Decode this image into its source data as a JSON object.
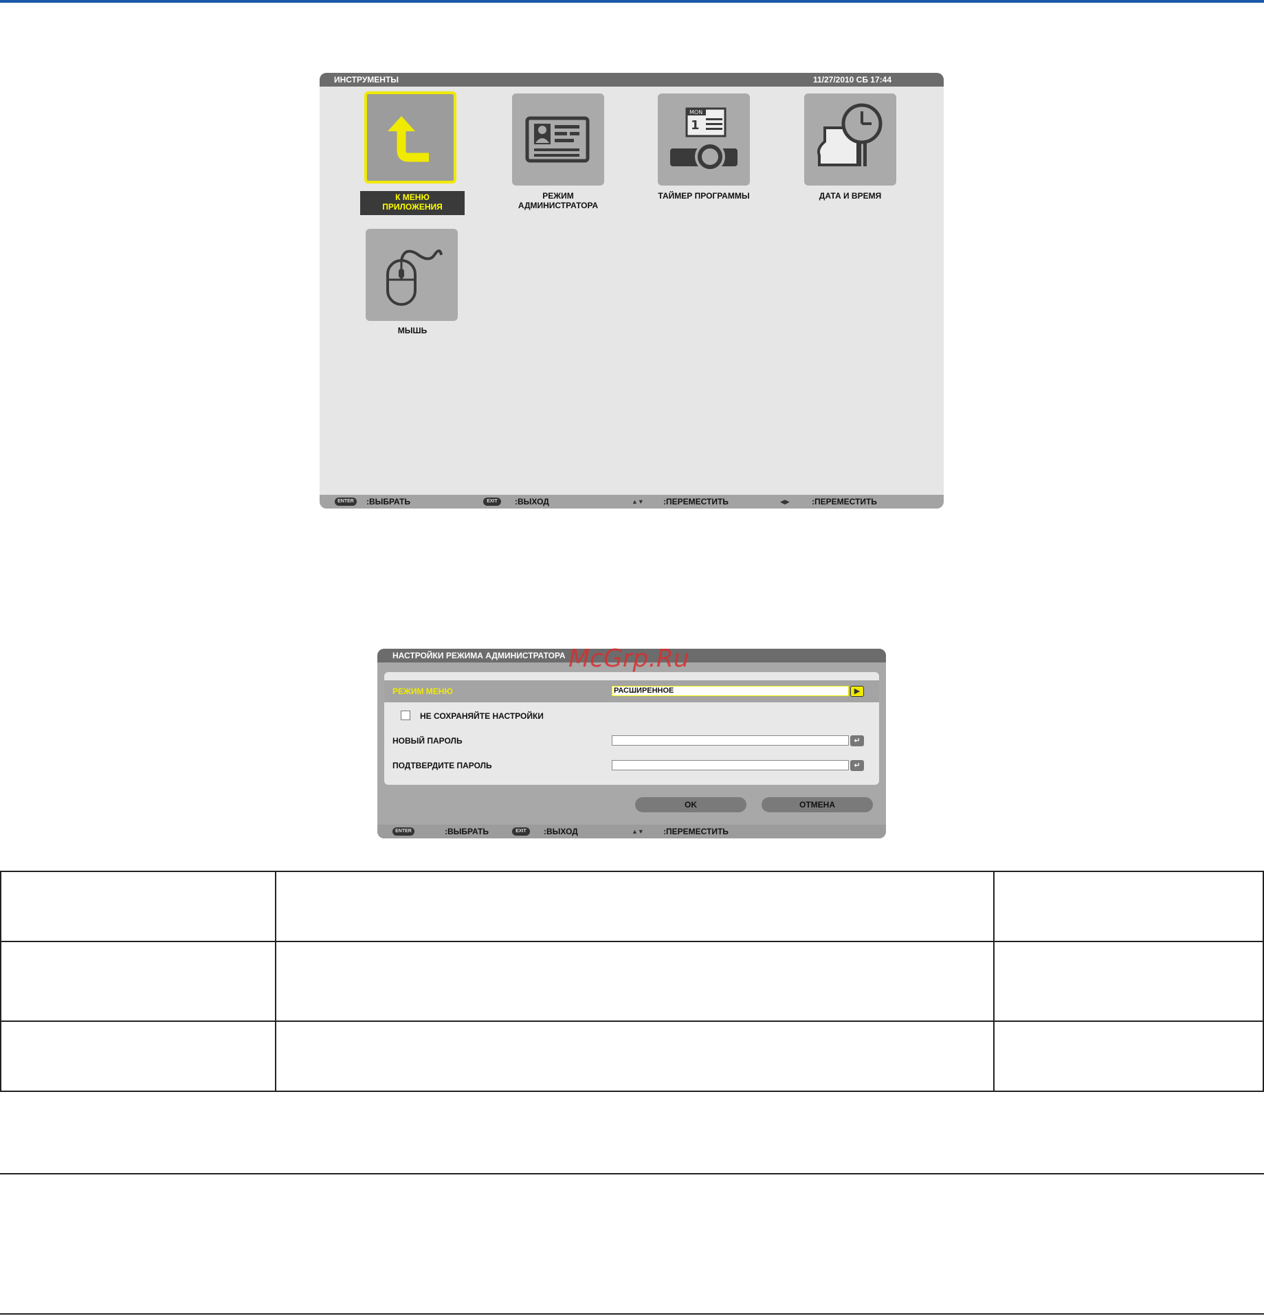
{
  "tools_window": {
    "title": "ИНСТРУМЕНТЫ",
    "datetime": "11/27/2010 СБ 17:44",
    "tiles": [
      {
        "label_line1": "К МЕНЮ",
        "label_line2": "ПРИЛОЖЕНИЯ",
        "icon": "return-arrow-icon",
        "selected": true
      },
      {
        "label_line1": "РЕЖИМ",
        "label_line2": "АДМИНИСТРАТОРА",
        "icon": "id-card-icon"
      },
      {
        "label_line1": "ТАЙМЕР ПРОГРАММЫ",
        "icon": "calendar-projector-icon"
      },
      {
        "label_line1": "ДАТА И ВРЕМЯ",
        "icon": "clock-calendar-icon"
      },
      {
        "label_line1": "МЫШЬ",
        "icon": "mouse-icon"
      }
    ],
    "footer": {
      "enter_key": "ENTER",
      "enter_label": ":ВЫБРАТЬ",
      "exit_key": "EXIT",
      "exit_label": ":ВЫХОД",
      "move_updown_label": ":ПЕРЕМЕСТИТЬ",
      "move_leftright_label": ":ПЕРЕМЕСТИТЬ"
    }
  },
  "admin_dialog": {
    "title": "НАСТРОЙКИ РЕЖИМА АДМИНИСТРАТОРА",
    "menu_mode_label": "РЕЖИМ МЕНЮ",
    "menu_mode_value": "РАСШИРЕННОЕ",
    "dont_save_label": "НЕ СОХРАНЯЙТЕ НАСТРОЙКИ",
    "new_password_label": "НОВЫЙ ПАРОЛЬ",
    "new_password_value": "",
    "confirm_password_label": "ПОДТВЕРДИТЕ ПАРОЛЬ",
    "confirm_password_value": "",
    "ok_label": "OK",
    "cancel_label": "ОТМЕНА",
    "footer": {
      "enter_key": "ENTER",
      "enter_label": ":ВЫБРАТЬ",
      "exit_key": "EXIT",
      "exit_label": ":ВЫХОД",
      "move_label": ":ПЕРЕМЕСТИТЬ"
    }
  },
  "watermark": "McGrp.Ru",
  "colors": {
    "accent_yellow": "#f0ea00",
    "titlebar": "#6c6c6c",
    "top_rule": "#1a5aa8"
  }
}
